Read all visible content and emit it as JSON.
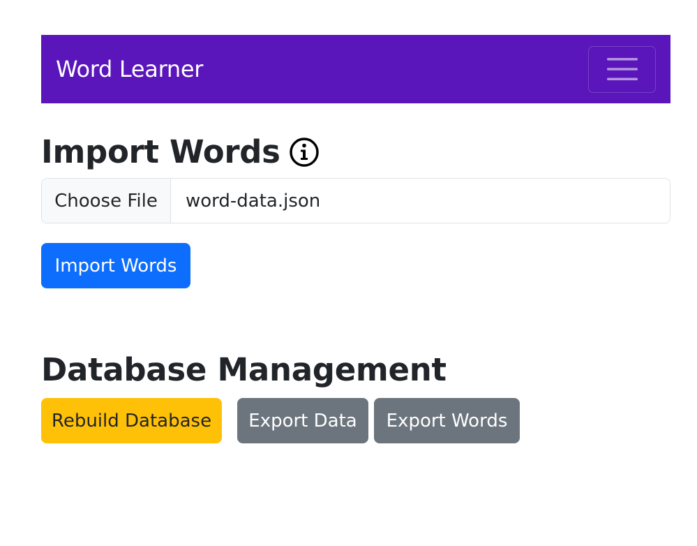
{
  "navbar": {
    "brand": "Word Learner",
    "toggler_icon": "hamburger-menu-icon",
    "bg_color": "#5a16bb"
  },
  "import_section": {
    "title": "Import Words",
    "info_icon": "info-circle-icon",
    "file_input": {
      "button_label": "Choose File",
      "file_name": "word-data.json"
    },
    "import_button": "Import Words"
  },
  "database_section": {
    "title": "Database Management",
    "rebuild_button": "Rebuild Database",
    "export_data_button": "Export Data",
    "export_words_button": "Export Words"
  },
  "colors": {
    "primary": "#0d6efd",
    "warning": "#ffc107",
    "secondary": "#6c757d"
  }
}
